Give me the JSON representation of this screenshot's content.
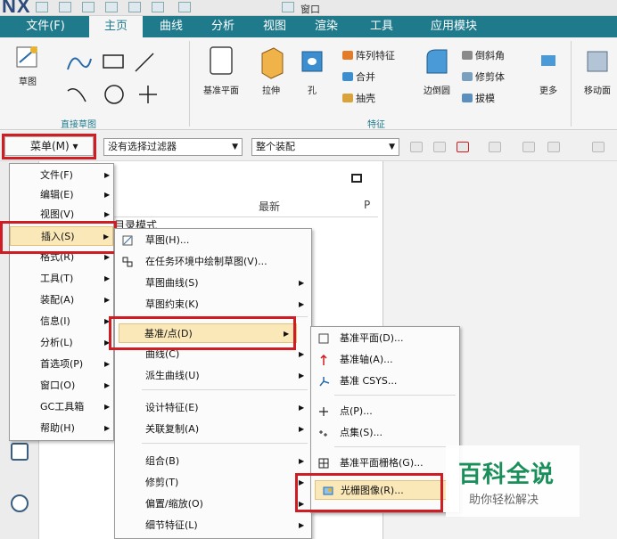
{
  "app": {
    "logo": "NX",
    "window_label": "窗口"
  },
  "tabs": [
    {
      "label": "文件(F)"
    },
    {
      "label": "主页"
    },
    {
      "label": "曲线"
    },
    {
      "label": "分析"
    },
    {
      "label": "视图"
    },
    {
      "label": "渲染"
    },
    {
      "label": "工具"
    },
    {
      "label": "应用模块"
    }
  ],
  "ribbon": {
    "sketch": "草图",
    "direct_sketch_group": "直接草图",
    "datum_plane": "基准平面",
    "extrude": "拉伸",
    "hole": "孔",
    "pattern_feature": "阵列特征",
    "unite": "合并",
    "shell": "抽壳",
    "edge_blend": "边倒圆",
    "chamfer": "倒斜角",
    "trim_body": "修剪体",
    "draft": "拔模",
    "more": "更多",
    "move_face": "移动面",
    "feature_group": "特征"
  },
  "cmdbar": {
    "menu_label": "菜单(M)",
    "filter_value": "没有选择过滤器",
    "assembly_value": "整个装配"
  },
  "panel": {
    "col_latest": "最新",
    "col_p": "P",
    "text": "目录模式"
  },
  "main_menu": [
    {
      "label": "文件(F)"
    },
    {
      "label": "编辑(E)"
    },
    {
      "label": "视图(V)"
    },
    {
      "label": "插入(S)"
    },
    {
      "label": "格式(R)"
    },
    {
      "label": "工具(T)"
    },
    {
      "label": "装配(A)"
    },
    {
      "label": "信息(I)"
    },
    {
      "label": "分析(L)"
    },
    {
      "label": "首选项(P)"
    },
    {
      "label": "窗口(O)"
    },
    {
      "label": "GC工具箱"
    },
    {
      "label": "帮助(H)"
    }
  ],
  "insert_menu": [
    {
      "label": "草图(H)..."
    },
    {
      "label": "在任务环境中绘制草图(V)..."
    },
    {
      "label": "草图曲线(S)"
    },
    {
      "label": "草图约束(K)"
    },
    {
      "label": "基准/点(D)"
    },
    {
      "label": "曲线(C)"
    },
    {
      "label": "派生曲线(U)"
    },
    {
      "label": "设计特征(E)"
    },
    {
      "label": "关联复制(A)"
    },
    {
      "label": "组合(B)"
    },
    {
      "label": "修剪(T)"
    },
    {
      "label": "偏置/缩放(O)"
    },
    {
      "label": "细节特征(L)"
    }
  ],
  "datum_menu": [
    {
      "label": "基准平面(D)..."
    },
    {
      "label": "基准轴(A)..."
    },
    {
      "label": "基准 CSYS..."
    },
    {
      "label": "点(P)..."
    },
    {
      "label": "点集(S)..."
    },
    {
      "label": "基准平面栅格(G)..."
    },
    {
      "label": "光栅图像(R)..."
    }
  ],
  "watermark": {
    "title": "百科全说",
    "subtitle": "助你轻松解决"
  },
  "colors": {
    "ribbon_tab": "#1f7a8c",
    "highlight_box": "#d01c23",
    "menu_hover": "#fbe8b8"
  }
}
